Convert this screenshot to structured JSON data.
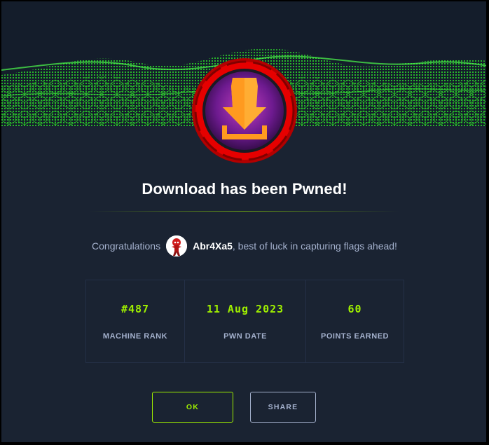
{
  "header": {
    "title": "Download has been Pwned!"
  },
  "congrats": {
    "prefix": "Congratulations",
    "username": "Abr4Xa5",
    "suffix": ", best of luck in capturing flags ahead!"
  },
  "stats": [
    {
      "value": "#487",
      "label": "MACHINE RANK"
    },
    {
      "value": "11 Aug 2023",
      "label": "PWN DATE"
    },
    {
      "value": "60",
      "label": "POINTS EARNED"
    }
  ],
  "actions": {
    "ok_label": "OK",
    "share_label": "SHARE"
  },
  "colors": {
    "accent": "#9fef00",
    "background": "#1a2332",
    "badge_ring": "#e60000"
  },
  "icons": {
    "badge": "download-arrow-icon"
  }
}
